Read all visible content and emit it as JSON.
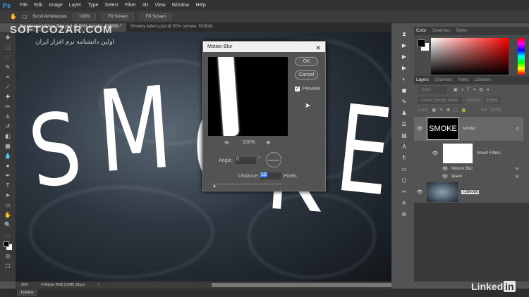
{
  "app": {
    "logo": "Ps",
    "menu": [
      "File",
      "Edit",
      "Image",
      "Layer",
      "Type",
      "Select",
      "Filter",
      "3D",
      "View",
      "Window",
      "Help"
    ]
  },
  "options": {
    "scroll_all": "Scroll All Windows",
    "zoom": "100%",
    "fit1": "Fit Screen",
    "fill": "Fill Screen"
  },
  "tabs": [
    {
      "label": "Randomized Wave filter.psd @ 50% (smoke, RGB/8) *"
    },
    {
      "label": "Smokey letters.psd @ 50% (smoke, RGB/8)"
    }
  ],
  "watermark": {
    "site": "SOFTCOZAR.COM",
    "tagline": "اولین دانشنامه نرم افزار ایران"
  },
  "canvas": {
    "letters": [
      "S",
      "M",
      "O",
      "K",
      "E"
    ]
  },
  "dialog": {
    "title": "Motion Blur",
    "ok": "OK",
    "cancel": "Cancel",
    "preview_label": "Preview",
    "preview_checked": true,
    "zoom": "100%",
    "angle_label": "Angle:",
    "angle_value": "0",
    "angle_unit": "°",
    "distance_label": "Distance:",
    "distance_value": "10",
    "distance_unit": "Pixels"
  },
  "color_panel": {
    "tabs": [
      "Color",
      "Swatches",
      "Styles"
    ],
    "foreground": "#000000",
    "background": "#ffffff"
  },
  "layers_panel": {
    "tabs": [
      "Layers",
      "Channels",
      "Paths",
      "Libraries"
    ],
    "filter": "Kind",
    "blend_mode": "Linear Dodge (Add)",
    "opacity_label": "Opacity:",
    "opacity": "100%",
    "lock_label": "Lock:",
    "fill_label": "Fill:",
    "fill": "100%",
    "layers": [
      {
        "name": "smoke",
        "thumb_text": "SMOKE"
      },
      {
        "name": "Smart Filters"
      },
      {
        "name": "Motion Blur"
      },
      {
        "name": "Wave"
      },
      {
        "name": "7286080"
      }
    ]
  },
  "status": {
    "zoom": "50%",
    "profile": "© Adobe RGB (1998) (8bpc)"
  },
  "timeline": {
    "label": "Timeline"
  },
  "brand": {
    "linked": "Linked",
    "in": "in"
  }
}
